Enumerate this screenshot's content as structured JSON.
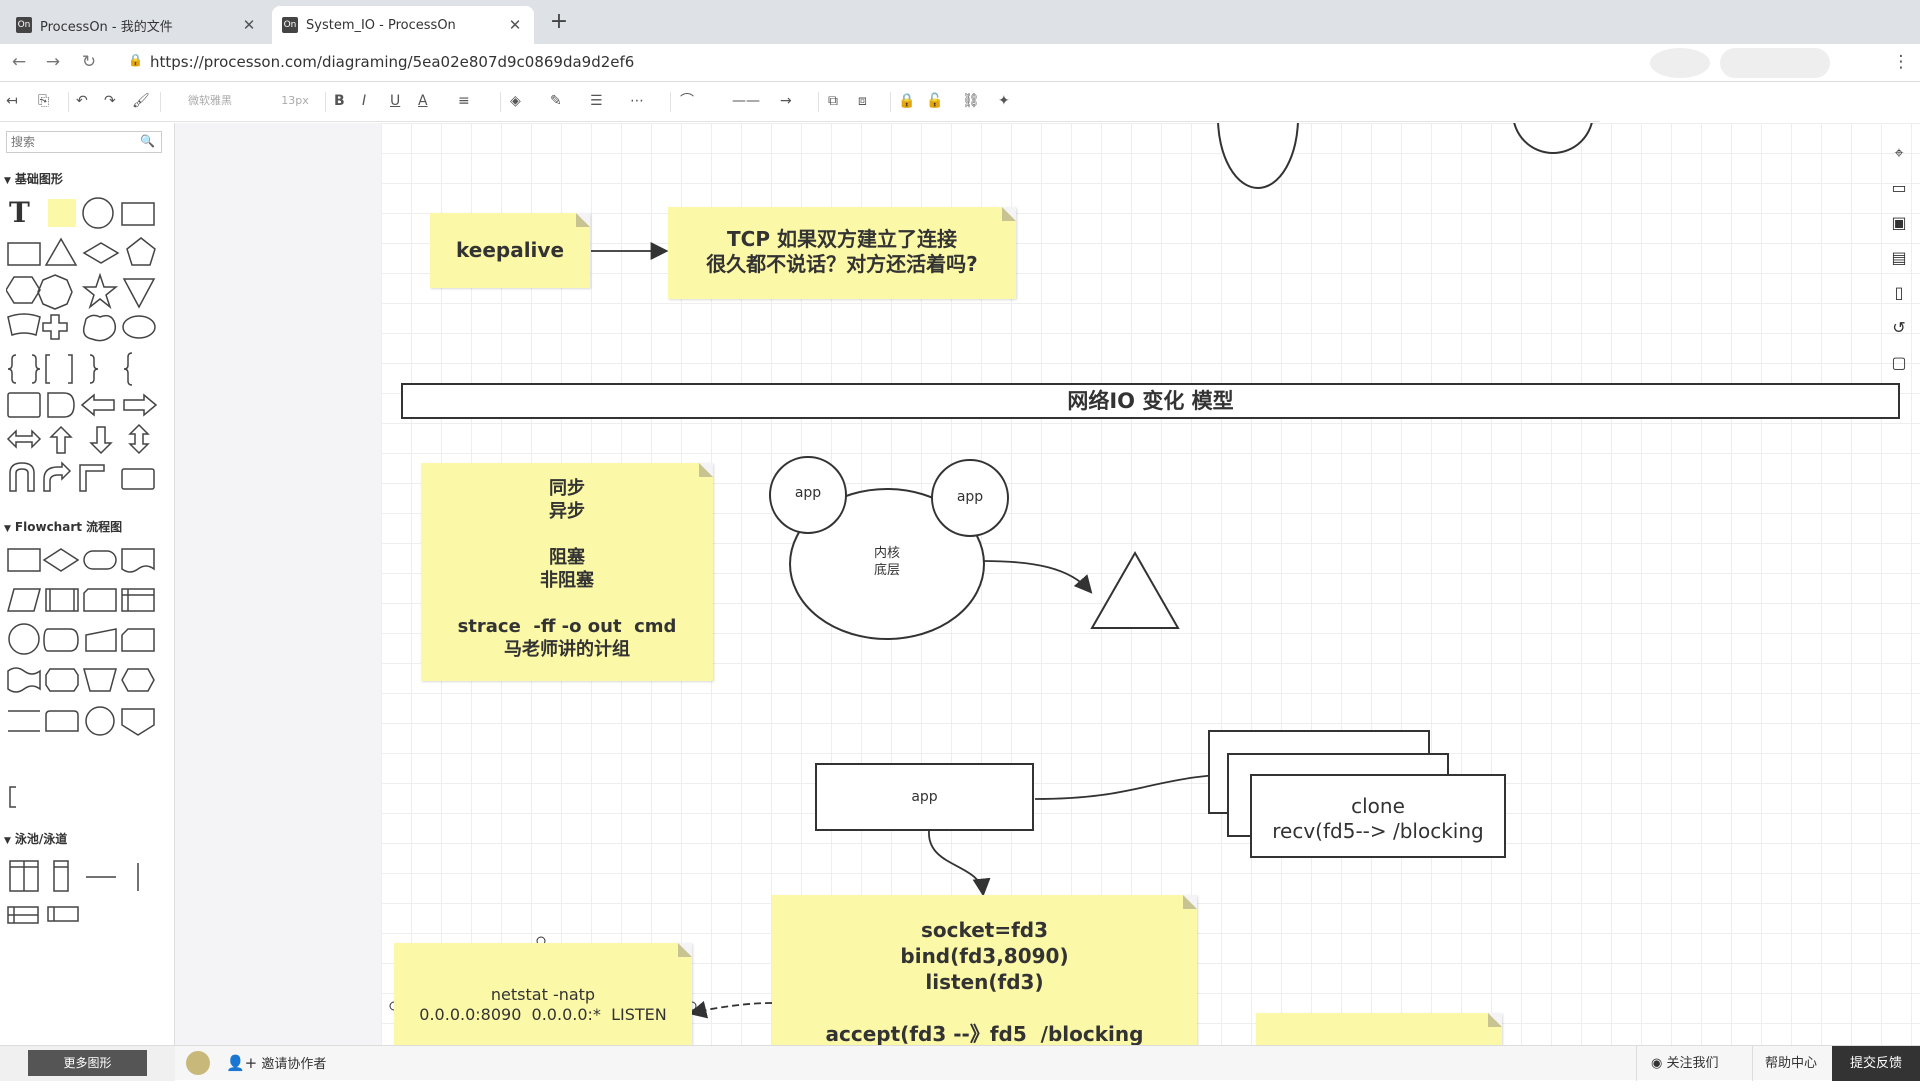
{
  "browser": {
    "tabs": [
      {
        "label": "ProcessOn - 我的文件",
        "favicon": "On",
        "close": "✕"
      },
      {
        "label": "System_IO - ProcessOn",
        "favicon": "On",
        "close": "✕"
      }
    ],
    "new_tab": "+",
    "url": "https://processon.com/diagraming/5ea02e807d9c0869da9d2ef6"
  },
  "toolbar": {
    "font_name": "微软雅黑",
    "font_size": "13px"
  },
  "sidebar": {
    "search_placeholder": "搜索",
    "categories": [
      "基础图形",
      "Flowchart 流程图",
      "泳池/泳道"
    ],
    "more_button": "更多图形"
  },
  "canvas": {
    "keepalive": "keepalive",
    "tcp_note": "TCP 如果双方建立了连接\n很久都不说话？对方还活着吗?",
    "pool_title": "网络IO 变化  模型",
    "sync_note": "同步\n异步\n\n阻塞\n非阻塞\n\nstrace  -ff -o out  cmd\n马老师讲的计组",
    "app_left": "app",
    "app_right": "app",
    "kernel": "内核\n底层",
    "app_box": "app",
    "clone_text": "clone\nrecv(fd5--> /blocking",
    "socket_note": "socket=fd3\nbind(fd3,8090)\nlisten(fd3)\n\naccept(fd3 --》fd5  /blocking",
    "netstat_note": "netstat -natp\n0.0.0.0:8090  0.0.0.0:*  LISTEN"
  },
  "statusbar": {
    "invite": "邀请协作者",
    "follow": "关注我们",
    "help": "帮助中心",
    "feedback": "提交反馈"
  }
}
